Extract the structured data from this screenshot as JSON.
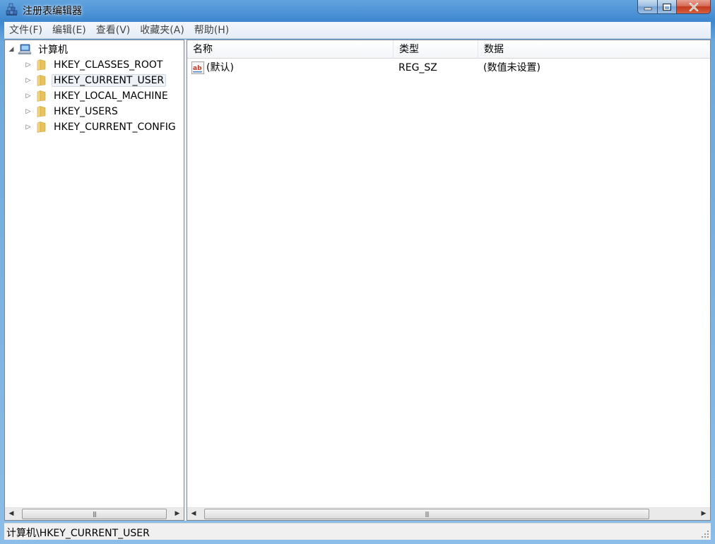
{
  "window": {
    "title": "注册表编辑器"
  },
  "menu": [
    {
      "label": "文件(F)"
    },
    {
      "label": "编辑(E)"
    },
    {
      "label": "查看(V)"
    },
    {
      "label": "收藏夹(A)"
    },
    {
      "label": "帮助(H)"
    }
  ],
  "tree": {
    "root": {
      "label": "计算机",
      "icon": "computer-icon",
      "expanded": true
    },
    "children": [
      {
        "label": "HKEY_CLASSES_ROOT",
        "selected": false
      },
      {
        "label": "HKEY_CURRENT_USER",
        "selected": true
      },
      {
        "label": "HKEY_LOCAL_MACHINE",
        "selected": false
      },
      {
        "label": "HKEY_USERS",
        "selected": false
      },
      {
        "label": "HKEY_CURRENT_CONFIG",
        "selected": false
      }
    ]
  },
  "list": {
    "columns": [
      {
        "label": "名称"
      },
      {
        "label": "类型"
      },
      {
        "label": "数据"
      }
    ],
    "rows": [
      {
        "name": "(默认)",
        "type": "REG_SZ",
        "data": "(数值未设置)",
        "icon": "string-value-icon"
      }
    ]
  },
  "status": {
    "path": "计算机\\HKEY_CURRENT_USER"
  },
  "colors": {
    "frame": "#3f88cf",
    "close_button": "#c23b1f",
    "folder": "#e8c25a"
  }
}
